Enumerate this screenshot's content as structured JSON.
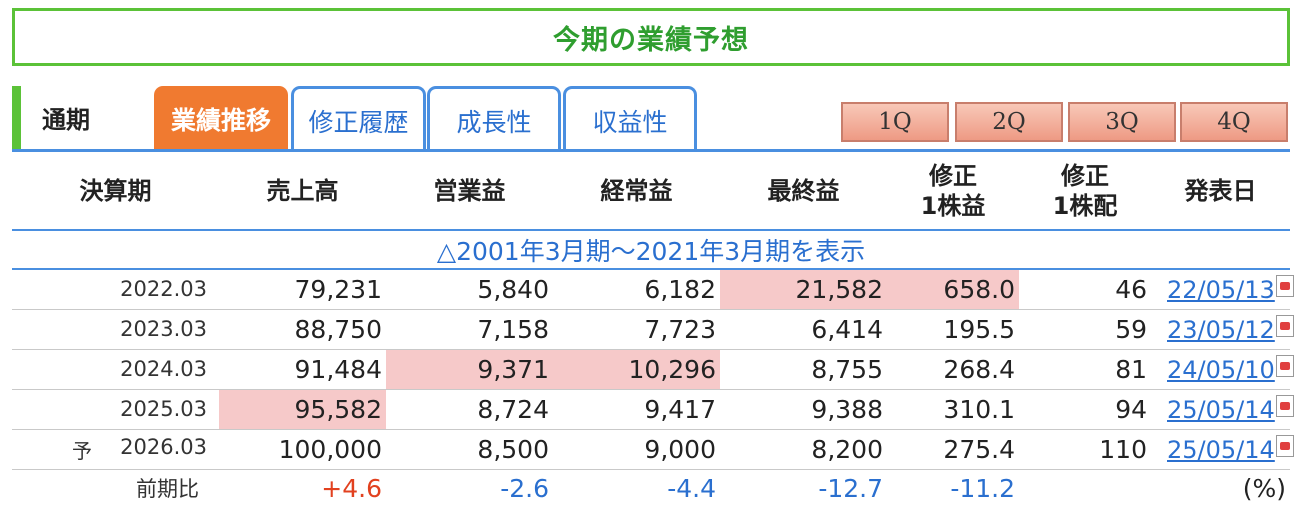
{
  "title": "今期の業績予想",
  "tabs": {
    "period_label": "通期",
    "items": [
      "業績推移",
      "修正履歴",
      "成長性",
      "収益性"
    ],
    "quarters": [
      "1Q",
      "2Q",
      "3Q",
      "4Q"
    ]
  },
  "headers": [
    "決算期",
    "売上高",
    "営業益",
    "経常益",
    "最終益",
    "修正\n1株益",
    "修正\n1株配",
    "発表日"
  ],
  "range_link": "△2001年3月期～2021年3月期を表示",
  "rows": [
    {
      "period": "2022.03",
      "sales": "79,231",
      "op": "5,840",
      "ord": "6,182",
      "net": "21,582",
      "eps": "658.0",
      "div": "46",
      "date": "22/05/13",
      "prefix": ""
    },
    {
      "period": "2023.03",
      "sales": "88,750",
      "op": "7,158",
      "ord": "7,723",
      "net": "6,414",
      "eps": "195.5",
      "div": "59",
      "date": "23/05/12",
      "prefix": ""
    },
    {
      "period": "2024.03",
      "sales": "91,484",
      "op": "9,371",
      "ord": "10,296",
      "net": "8,755",
      "eps": "268.4",
      "div": "81",
      "date": "24/05/10",
      "prefix": ""
    },
    {
      "period": "2025.03",
      "sales": "95,582",
      "op": "8,724",
      "ord": "9,417",
      "net": "9,388",
      "eps": "310.1",
      "div": "94",
      "date": "25/05/14",
      "prefix": ""
    },
    {
      "period": "2026.03",
      "sales": "100,000",
      "op": "8,500",
      "ord": "9,000",
      "net": "8,200",
      "eps": "275.4",
      "div": "110",
      "date": "25/05/14",
      "prefix": "予"
    }
  ],
  "comparison": {
    "label": "前期比",
    "sales": "+4.6",
    "op": "-2.6",
    "ord": "-4.4",
    "net": "-12.7",
    "eps": "-11.2",
    "unit": "(%)"
  },
  "colors": {
    "accent_green": "#5bc238",
    "tab_orange": "#f07a30",
    "link_blue": "#2a6fcf",
    "highlight": "#f6c9c9"
  }
}
